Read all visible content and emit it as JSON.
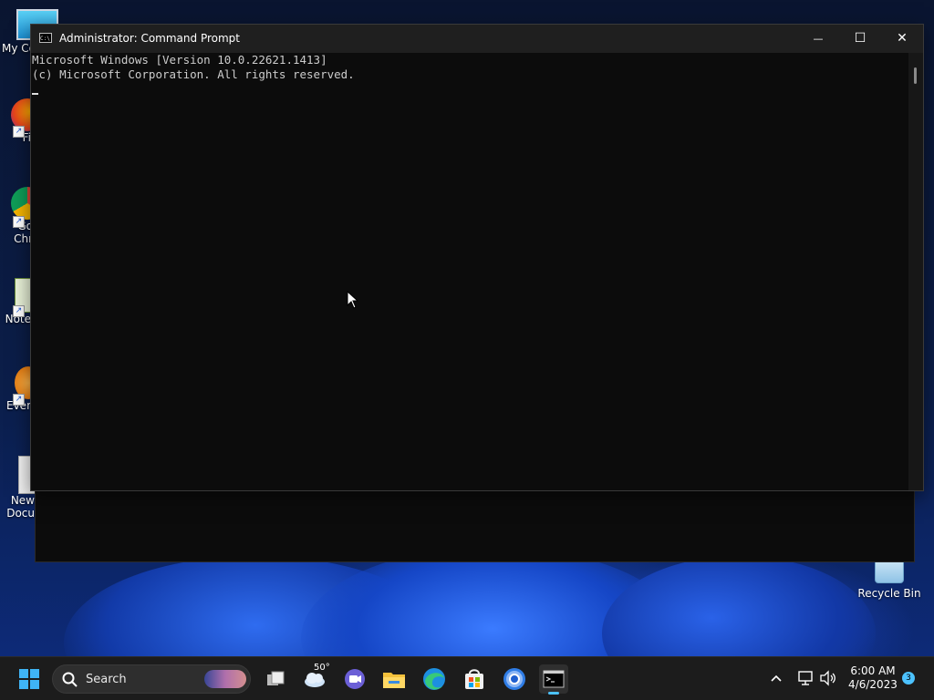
{
  "window": {
    "title": "Administrator: Command Prompt",
    "minimize_glyph": "—",
    "maximize_glyph": "☐",
    "close_glyph": "✕"
  },
  "console": {
    "lines": [
      "Microsoft Windows [Version 10.0.22621.1413]",
      "(c) Microsoft Corporation. All rights reserved."
    ]
  },
  "desktop_icons": [
    {
      "label": "My Co",
      "icon": "computer-icon"
    },
    {
      "label": "Fi",
      "icon": "firefox-icon"
    },
    {
      "label": "Go Chr",
      "icon": "chrome-icon"
    },
    {
      "label": "Note",
      "icon": "notepad-icon"
    },
    {
      "label": "Ever",
      "icon": "everything-icon"
    },
    {
      "label": "New Docu",
      "icon": "text-document-icon"
    },
    {
      "label": "Recycle Bin",
      "icon": "recycle-bin-icon"
    }
  ],
  "taskbar": {
    "search_label": "Search",
    "weather_temp": "50°",
    "apps": [
      "start-icon",
      "task-view-icon",
      "weather-icon",
      "teams-chat-icon",
      "file-explorer-icon",
      "edge-icon",
      "store-icon",
      "chrome-icon",
      "command-prompt-icon"
    ],
    "tray": {
      "time": "6:00 AM",
      "date": "4/6/2023",
      "notification_count": "3"
    }
  },
  "colors": {
    "console_bg": "#0c0c0c",
    "console_text": "#cccccc",
    "titlebar": "#1f1f1f",
    "taskbar": "#1c1c1c",
    "accent": "#4cc2ff"
  }
}
